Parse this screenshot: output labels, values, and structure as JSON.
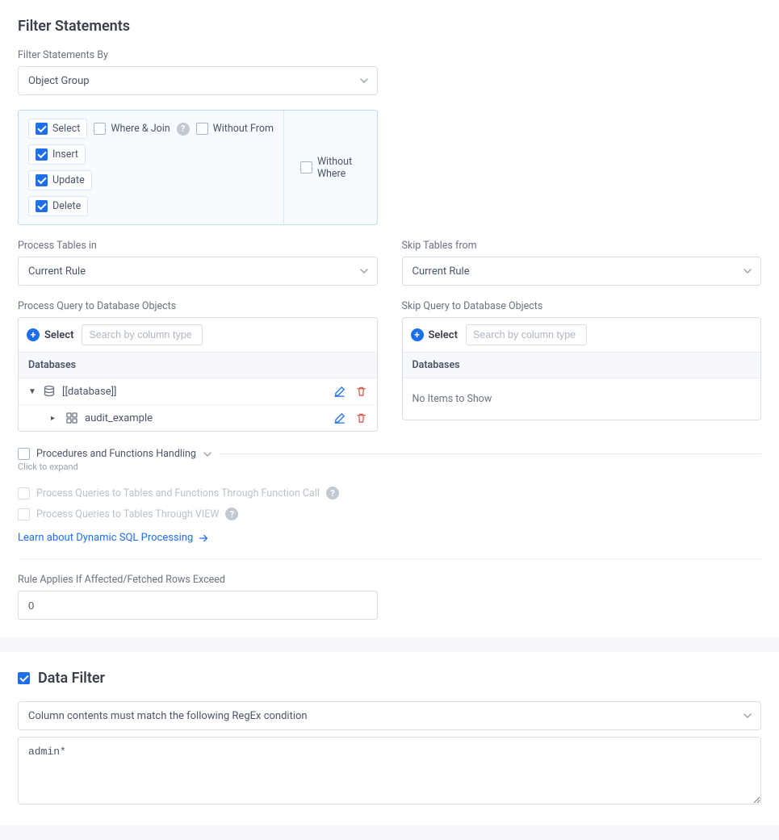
{
  "filterStatements": {
    "title": "Filter Statements",
    "filterByLabel": "Filter Statements By",
    "filterByValue": "Object Group",
    "statements": {
      "select": {
        "label": "Select",
        "checked": true
      },
      "insert": {
        "label": "Insert",
        "checked": true
      },
      "update": {
        "label": "Update",
        "checked": true
      },
      "delete": {
        "label": "Delete",
        "checked": true
      },
      "whereJoin": {
        "label": "Where & Join",
        "checked": false
      },
      "withoutFrom": {
        "label": "Without From",
        "checked": false
      },
      "withoutWhere": {
        "label": "Without Where",
        "checked": false
      }
    },
    "processTablesLabel": "Process Tables in",
    "processTablesValue": "Current Rule",
    "skipTablesLabel": "Skip Tables from",
    "skipTablesValue": "Current Rule",
    "processQueryLabel": "Process Query to Database Objects",
    "skipQueryLabel": "Skip Query to Database Objects",
    "selectBtn": "Select",
    "searchPlaceholder": "Search by column type",
    "databasesHeader": "Databases",
    "tree": {
      "db": "[[database]]",
      "schema": "audit_example"
    },
    "noItems": "No Items to Show",
    "procHandling": "Procedures and Functions Handling",
    "clickExpand": "Click to expand",
    "procThroughCall": "Process Queries to Tables and Functions Through Function Call",
    "procThroughView": "Process Queries to Tables Through VIEW",
    "learnLink": "Learn about Dynamic SQL Processing",
    "rowsExceedLabel": "Rule Applies If Affected/Fetched Rows Exceed",
    "rowsExceedValue": "0"
  },
  "dataFilter": {
    "title": "Data Filter",
    "checked": true,
    "conditionValue": "Column contents must match the following RegEx condition",
    "regexValue": "admin*"
  }
}
